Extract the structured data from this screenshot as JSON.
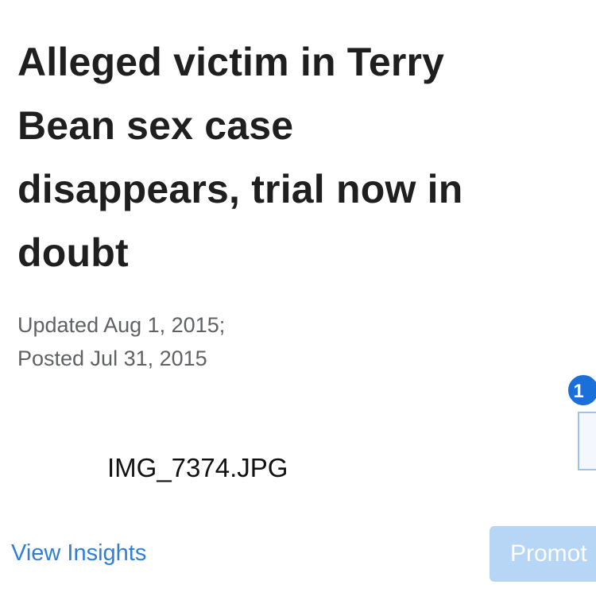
{
  "article": {
    "headline_lines": [
      "Alleged victim in Terry",
      "Bean sex case",
      "disappears, trial now in",
      "doubt"
    ],
    "updated": "Updated Aug 1, 2015;",
    "posted": "Posted Jul 31, 2015"
  },
  "attachment": {
    "filename": "IMG_7374.JPG",
    "badge_count": "1"
  },
  "actions": {
    "view_insights_label": "View Insights",
    "promote_label": "Promot"
  },
  "colors": {
    "link": "#2f7fd9",
    "promote_bg": "#b7d5f4",
    "badge_bg": "#1b6fd8",
    "meta_text": "#5f6164"
  }
}
